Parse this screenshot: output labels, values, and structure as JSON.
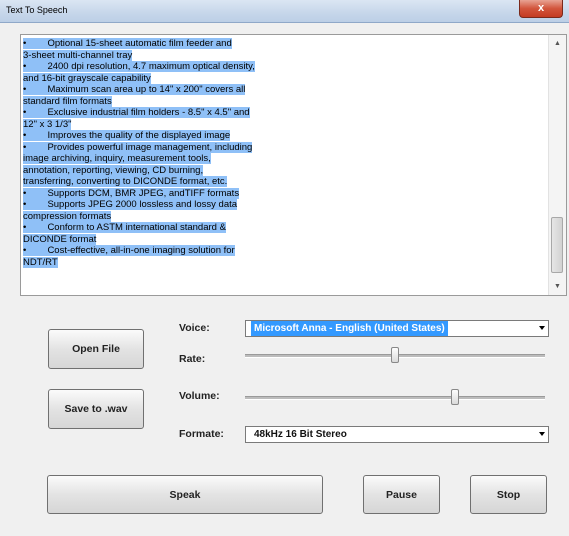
{
  "window": {
    "title": "Text To Speech",
    "close_label": "x"
  },
  "text_area": {
    "lines": [
      "•        Optional 15-sheet automatic film feeder and",
      "3-sheet multi-channel tray",
      "•        2400 dpi resolution, 4.7 maximum optical density,",
      "and 16-bit grayscale capability",
      "•        Maximum scan area up to 14\" x 200\" covers all",
      "standard film formats",
      "•        Exclusive industrial film holders - 8.5\" x 4.5\" and",
      "12\" x 3 1/3\"",
      "•        Improves the quality of the displayed image",
      "•        Provides powerful image management, including",
      "image archiving, inquiry, measurement tools,",
      "annotation, reporting, viewing, CD burning,",
      "transferring, converting to DICONDE format, etc.",
      "•        Supports DCM, BMR JPEG, andTIFF formats",
      "•        Supports JPEG 2000 lossless and lossy data",
      "compression formats",
      "•        Conform to ASTM international standard &",
      "DICONDE format",
      "•        Cost-effective, all-in-one imaging solution for",
      "NDT/RT"
    ]
  },
  "buttons": {
    "open_file": "Open File",
    "save_wav": "Save to .wav",
    "speak": "Speak",
    "pause": "Pause",
    "stop": "Stop"
  },
  "labels": {
    "voice": "Voice:",
    "rate": "Rate:",
    "volume": "Volume:",
    "formate": "Formate:"
  },
  "voice_select": {
    "value": "Microsoft Anna - English (United States)"
  },
  "format_select": {
    "value": "48kHz 16 Bit Stereo"
  },
  "rate_slider": {
    "value_fraction": 0.5
  },
  "volume_slider": {
    "value_fraction": 0.7
  },
  "icons": {
    "close": "close-icon",
    "combo_caret": "chevron-down-icon",
    "scroll_up": "scroll-up-arrow",
    "scroll_down": "scroll-down-arrow"
  },
  "colors": {
    "selection": "#8fc0f7",
    "combo_highlight": "#3399ff",
    "close_button": "#d2553c"
  }
}
